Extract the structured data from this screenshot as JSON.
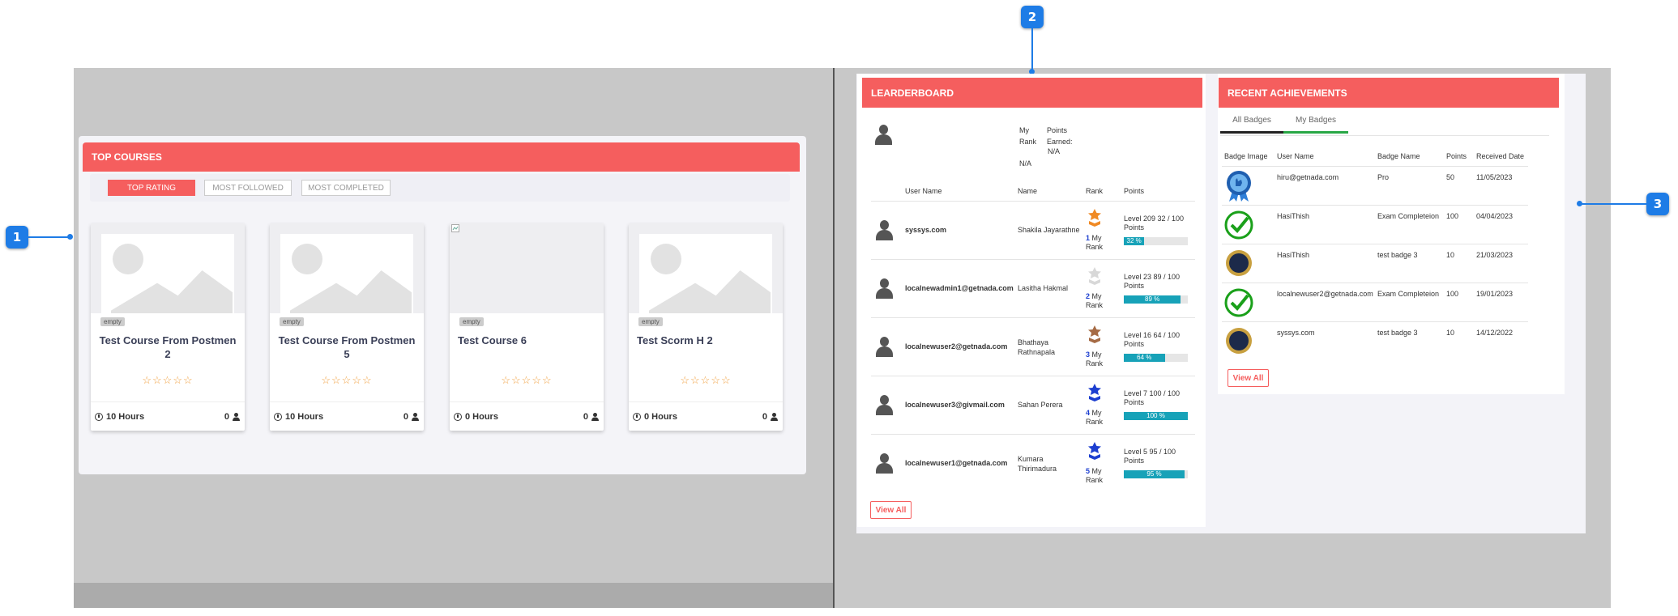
{
  "top_courses": {
    "title": "TOP COURSES",
    "filters": [
      "TOP RATING",
      "MOST FOLLOWED",
      "MOST COMPLETED"
    ],
    "courses": [
      {
        "badge": "empty",
        "title": "Test Course From Postmen 2",
        "stars": "☆☆☆☆☆",
        "hours": "10 Hours",
        "count": "0"
      },
      {
        "badge": "empty",
        "title": "Test Course From Postmen 5",
        "stars": "☆☆☆☆☆",
        "hours": "10 Hours",
        "count": "0"
      },
      {
        "badge": "empty",
        "title": "Test Course 6",
        "stars": "☆☆☆☆☆",
        "hours": "0 Hours",
        "count": "0"
      },
      {
        "badge": "empty",
        "title": "Test Scorm H 2",
        "stars": "☆☆☆☆☆",
        "hours": "0 Hours",
        "count": "0"
      }
    ]
  },
  "leaderboard": {
    "title": "LEARDERBOARD",
    "my_rank_label": "My Rank",
    "my_rank_value": "N/A",
    "points_earned_label": "Points Earned:",
    "points_earned_value": "N/A",
    "columns": [
      "User Name",
      "Name",
      "Rank",
      "Points"
    ],
    "rows": [
      {
        "user": "syssys.com",
        "name": "Shakila Jayarathne",
        "rank": "1",
        "rank_label": "My Rank",
        "level": "Level 209 32 / 100 Points",
        "progress": 32,
        "progress_label": "32 %",
        "medal_color": "#f08a24"
      },
      {
        "user": "localnewadmin1@getnada.com",
        "name": "Lasitha Hakmal",
        "rank": "2",
        "rank_label": "My Rank",
        "level": "Level 23 89 / 100 Points",
        "progress": 89,
        "progress_label": "89 %",
        "medal_color": "#d8d8d8"
      },
      {
        "user": "localnewuser2@getnada.com",
        "name": "Bhathaya Rathnapala",
        "rank": "3",
        "rank_label": "My Rank",
        "level": "Level 16 64 / 100 Points",
        "progress": 64,
        "progress_label": "64 %",
        "medal_color": "#a66b45"
      },
      {
        "user": "localnewuser3@givmail.com",
        "name": "Sahan Perera",
        "rank": "4",
        "rank_label": "My Rank",
        "level": "Level 7 100 / 100 Points",
        "progress": 100,
        "progress_label": "100 %",
        "medal_color": "#1d3fd0"
      },
      {
        "user": "localnewuser1@getnada.com",
        "name": "Kumara Thirimadura",
        "rank": "5",
        "rank_label": "My Rank",
        "level": "Level 5 95 / 100 Points",
        "progress": 95,
        "progress_label": "95 %",
        "medal_color": "#1d3fd0"
      }
    ],
    "view_all": "View All"
  },
  "recent_achievements": {
    "title": "RECENT ACHIEVEMENTS",
    "tabs": [
      "All Badges",
      "My Badges"
    ],
    "columns": [
      "Badge Image",
      "User Name",
      "Badge Name",
      "Points",
      "Received Date"
    ],
    "rows": [
      {
        "badge_icon": "pro-seal-icon",
        "user": "hiru@getnada.com",
        "badge": "Pro",
        "points": "50",
        "date": "11/05/2023"
      },
      {
        "badge_icon": "checkmark-icon",
        "user": "HasiThish",
        "badge": "Exam Completeion",
        "points": "100",
        "date": "04/04/2023"
      },
      {
        "badge_icon": "gold-medal-icon",
        "user": "HasiThish",
        "badge": "test badge 3",
        "points": "10",
        "date": "21/03/2023"
      },
      {
        "badge_icon": "checkmark-icon",
        "user": "localnewuser2@getnada.com",
        "badge": "Exam Completeion",
        "points": "100",
        "date": "19/01/2023"
      },
      {
        "badge_icon": "gold-medal-icon",
        "user": "syssys.com",
        "badge": "test badge 3",
        "points": "10",
        "date": "14/12/2022"
      }
    ],
    "view_all": "View All"
  },
  "callouts": [
    "1",
    "2",
    "3"
  ],
  "colors": {
    "accent": "#f55e5e",
    "callout": "#1e7ce6",
    "progress": "#17a2b8"
  }
}
